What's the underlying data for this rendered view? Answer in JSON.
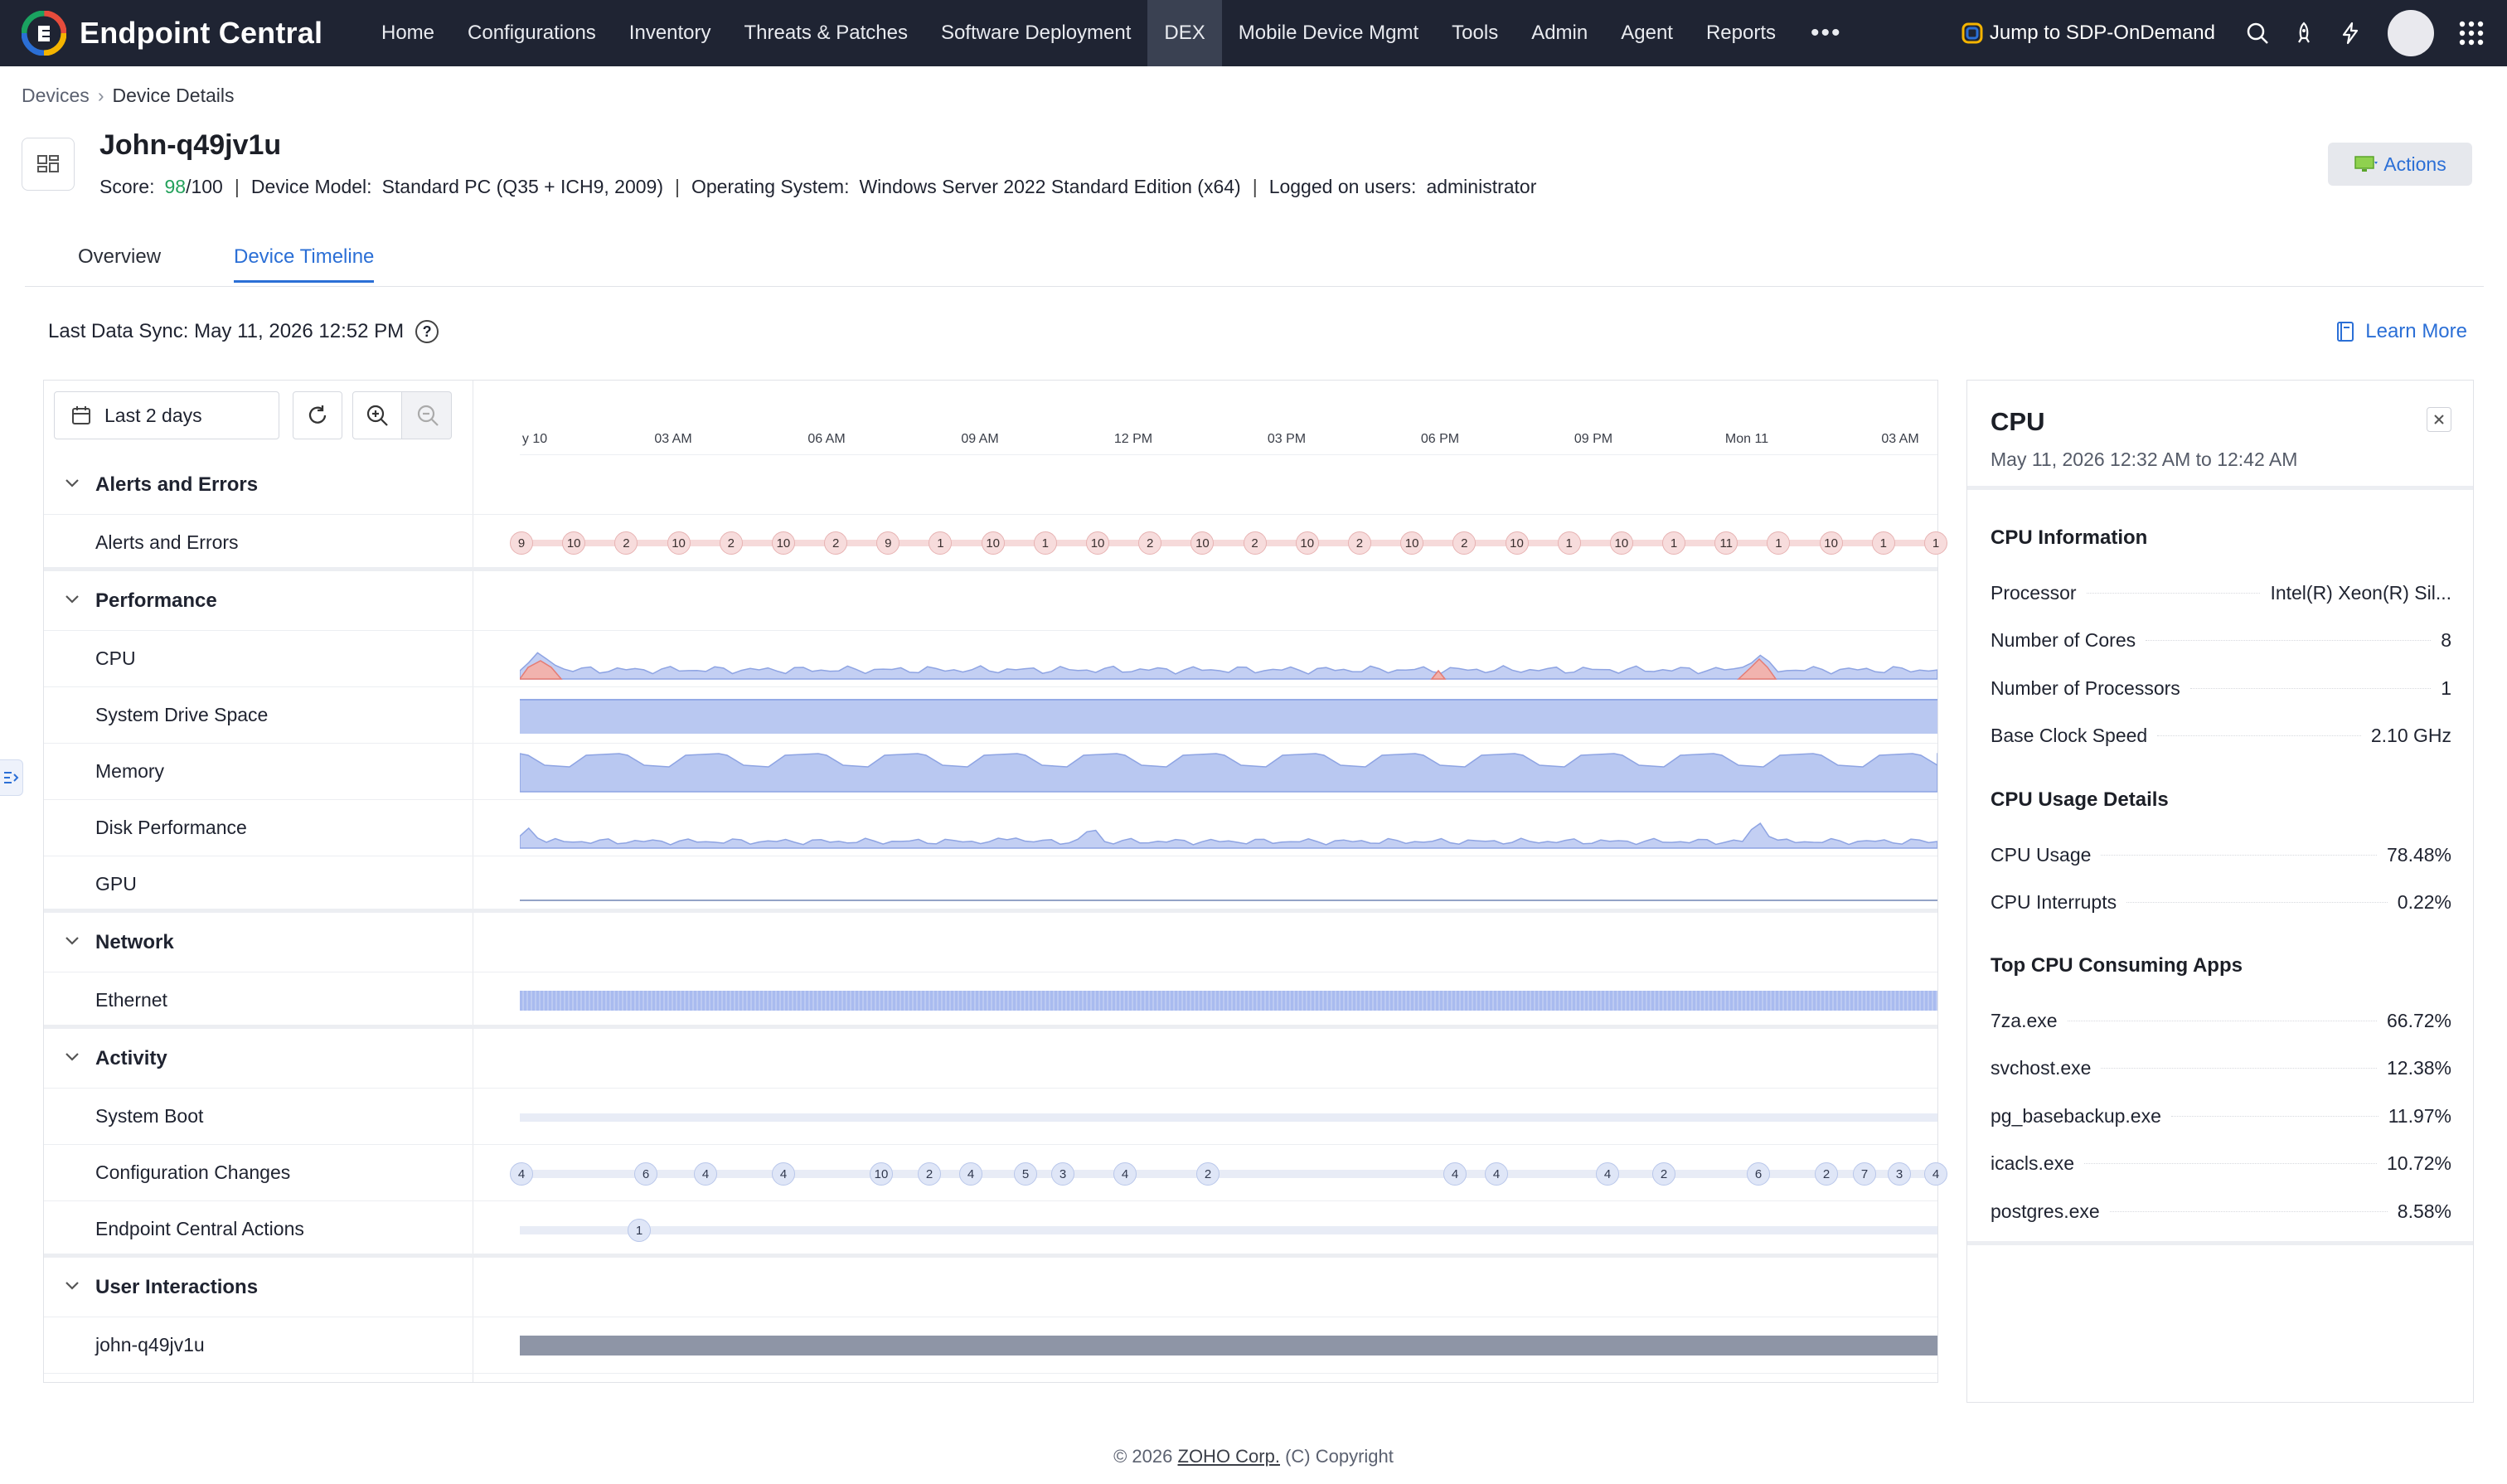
{
  "app": {
    "name": "Endpoint Central",
    "nav": [
      "Home",
      "Configurations",
      "Inventory",
      "Threats & Patches",
      "Software Deployment",
      "DEX",
      "Mobile Device Mgmt",
      "Tools",
      "Admin",
      "Agent",
      "Reports"
    ],
    "active_nav_index": 5,
    "more_label": "•••",
    "sdp_link": "Jump to SDP-OnDemand"
  },
  "breadcrumb": {
    "parent": "Devices",
    "current": "Device Details"
  },
  "device": {
    "name": "John-q49jv1u",
    "score_label": "Score:",
    "score": "98",
    "score_max": "/100",
    "model_label": "Device Model:",
    "model": "Standard PC (Q35 + ICH9, 2009)",
    "os_label": "Operating System:",
    "os": "Windows Server 2022 Standard Edition (x64)",
    "users_label": "Logged on users:",
    "users": "administrator"
  },
  "actions_label": "Actions",
  "tabs": [
    "Overview",
    "Device Timeline"
  ],
  "active_tab": 1,
  "last_sync": "Last Data Sync: May 11, 2026 12:52 PM",
  "learn_more": "Learn More",
  "timeline": {
    "range_label": "Last 2 days",
    "ticks": [
      "y 10",
      "03 AM",
      "06 AM",
      "09 AM",
      "12 PM",
      "03 PM",
      "06 PM",
      "09 PM",
      "Mon 11",
      "03 AM"
    ],
    "sections": [
      {
        "title": "Alerts and Errors",
        "rows": [
          "Alerts and Errors"
        ]
      },
      {
        "title": "Performance",
        "rows": [
          "CPU",
          "System Drive Space",
          "Memory",
          "Disk Performance",
          "GPU"
        ]
      },
      {
        "title": "Network",
        "rows": [
          "Ethernet"
        ]
      },
      {
        "title": "Activity",
        "rows": [
          "System Boot",
          "Configuration Changes",
          "Endpoint Central Actions"
        ]
      },
      {
        "title": "User Interactions",
        "rows": [
          "john-q49jv1u"
        ]
      }
    ],
    "alert_badges": [
      "9",
      "10",
      "2",
      "10",
      "2",
      "10",
      "2",
      "9",
      "1",
      "10",
      "1",
      "10",
      "2",
      "10",
      "2",
      "10",
      "2",
      "10",
      "2",
      "10",
      "1",
      "10",
      "1",
      "11",
      "1",
      "10",
      "1",
      "1"
    ],
    "config_badges": [
      "4",
      "6",
      "4",
      "4",
      "10",
      "2",
      "4",
      "5",
      "3",
      "4",
      "2",
      "4",
      "4",
      "4",
      "2",
      "6",
      "2",
      "7",
      "3",
      "4"
    ],
    "ec_action_badges": [
      "1"
    ]
  },
  "cpu_panel": {
    "title": "CPU",
    "subtitle": "May 11, 2026 12:32 AM to 12:42 AM",
    "info_title": "CPU Information",
    "info": [
      {
        "k": "Processor",
        "v": "Intel(R) Xeon(R) Sil..."
      },
      {
        "k": "Number of Cores",
        "v": "8"
      },
      {
        "k": "Number of Processors",
        "v": "1"
      },
      {
        "k": "Base Clock Speed",
        "v": "2.10 GHz"
      }
    ],
    "usage_title": "CPU Usage Details",
    "usage": [
      {
        "k": "CPU Usage",
        "v": "78.48%"
      },
      {
        "k": "CPU Interrupts",
        "v": "0.22%"
      }
    ],
    "apps_title": "Top CPU Consuming Apps",
    "apps": [
      {
        "k": "7za.exe",
        "v": "66.72%"
      },
      {
        "k": "svchost.exe",
        "v": "12.38%"
      },
      {
        "k": "pg_basebackup.exe",
        "v": "11.97%"
      },
      {
        "k": "icacls.exe",
        "v": "10.72%"
      },
      {
        "k": "postgres.exe",
        "v": "8.58%"
      }
    ]
  },
  "footer": {
    "prefix": "© 2026 ",
    "company": "ZOHO Corp.",
    "suffix": " (C) Copyright"
  },
  "colors": {
    "nav_bg": "#1f2433",
    "accent": "#2b6fd6",
    "score_green": "#23a15b",
    "chart_blue": "#b8c7f0",
    "chart_red": "#f0aaa6"
  }
}
